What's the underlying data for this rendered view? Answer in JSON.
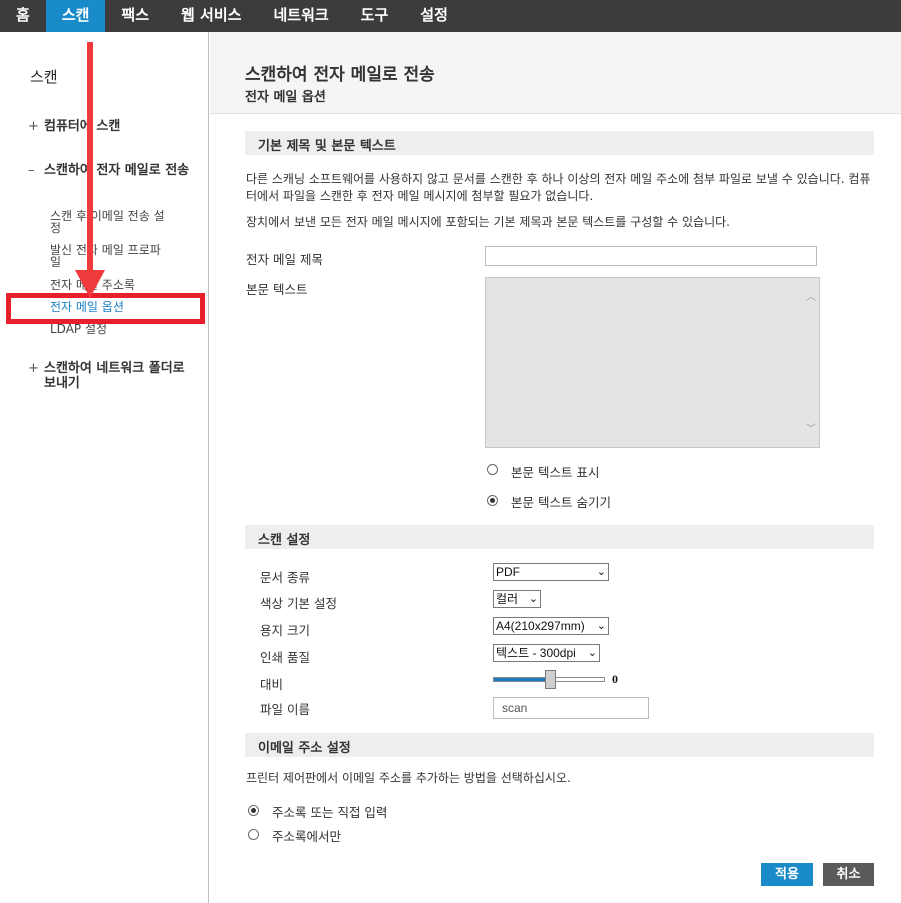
{
  "nav": {
    "tabs": [
      "홈",
      "스캔",
      "팩스",
      "웹 서비스",
      "네트워크",
      "도구",
      "설정"
    ],
    "active_index": 1
  },
  "sidebar": {
    "title": "스캔",
    "groups": [
      {
        "sign": "+",
        "label": "컴퓨터에 스캔"
      },
      {
        "sign": "–",
        "label": "스캔하여 전자 메일로 전송"
      },
      {
        "sign": "+",
        "label": "스캔하여 네트워크 폴더로 보내기"
      }
    ],
    "items": [
      "스캔 후 이메일 전송 설정",
      "발신 전자 메일 프로파일",
      "전자 메일 주소록",
      "전자 메일 옵션",
      "LDAP 설정"
    ],
    "active_item_index": 3,
    "highlight_color": "#e8202c"
  },
  "main": {
    "title": "스캔하여 전자 메일로 전송",
    "subtitle": "전자 메일 옵션",
    "section1": {
      "header": "기본 제목 및 본문 텍스트",
      "para1": "다른 스캐닝 소프트웨어를 사용하지 않고 문서를 스캔한 후 하나 이상의 전자 메일 주소에 첨부 파일로 보낼 수 있습니다. 컴퓨터에서 파일을 스캔한 후 전자 메일 메시지에 첨부할 필요가 없습니다.",
      "para2": "장치에서 보낸 모든 전자 메일 메시지에 포함되는 기본 제목과 본문 텍스트를 구성할 수 있습니다.",
      "subject_label": "전자 메일 제목",
      "subject_value": "",
      "body_label": "본문 텍스트",
      "radio_show": "본문 텍스트 표시",
      "radio_hide": "본문 텍스트 숨기기",
      "selected": "hide"
    },
    "section2": {
      "header": "스캔 설정",
      "doc_type_label": "문서 종류",
      "doc_type_value": "PDF",
      "color_label": "색상 기본 설정",
      "color_value": "컬러",
      "paper_label": "용지 크기",
      "paper_value": "A4(210x297mm)",
      "quality_label": "인쇄 품질",
      "quality_value": "텍스트 - 300dpi",
      "contrast_label": "대비",
      "contrast_value": "0",
      "filename_label": "파일 이름",
      "filename_value": "scan"
    },
    "section3": {
      "header": "이메일 주소 설정",
      "para": "프린터 제어판에서 이메일 주소를 추가하는 방법을 선택하십시오.",
      "opt1": "주소록 또는 직접 입력",
      "opt2": "주소록에서만",
      "selected": "opt1"
    },
    "apply_label": "적용",
    "cancel_label": "취소"
  }
}
